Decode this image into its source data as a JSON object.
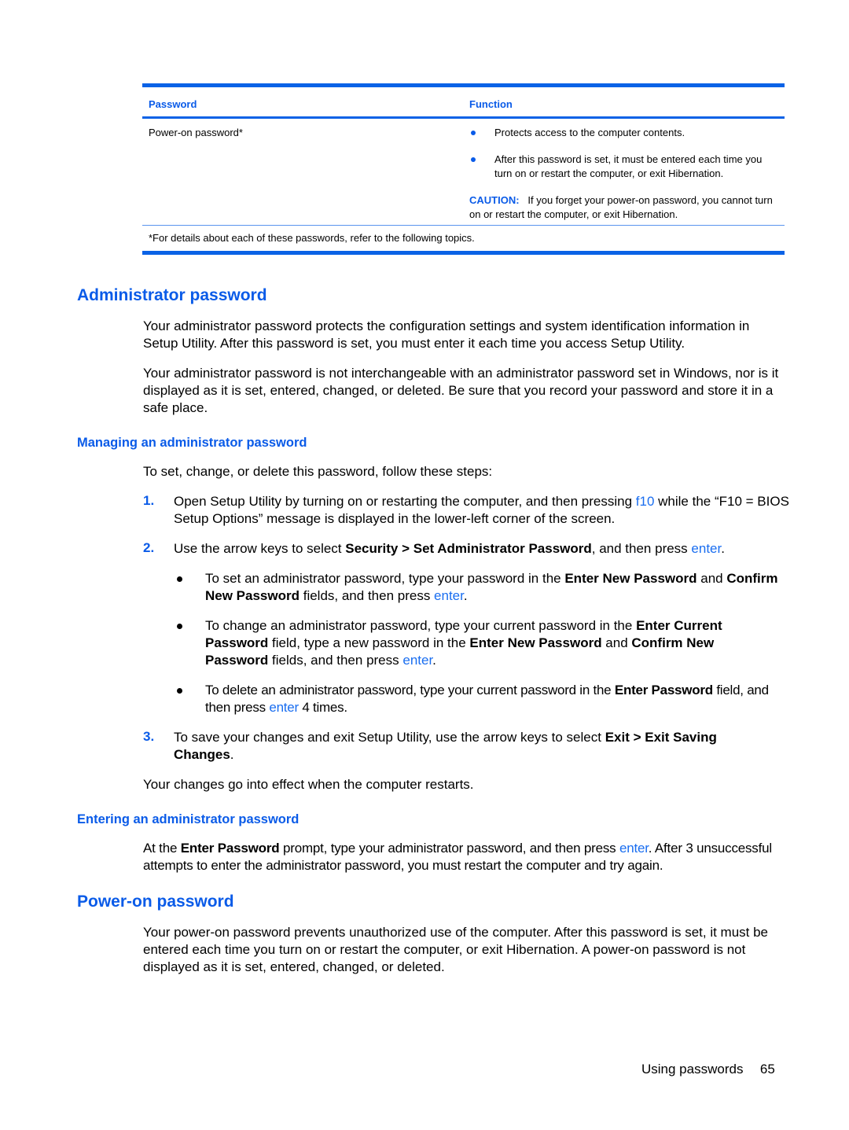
{
  "table": {
    "headers": [
      "Password",
      "Function"
    ],
    "row": {
      "password": "Power-on password*",
      "functions": [
        "Protects access to the computer contents.",
        "After this password is set, it must be entered each time you turn on or restart the computer, or exit Hibernation."
      ],
      "caution_label": "CAUTION:",
      "caution_text": "If you forget your power-on password, you cannot turn on or restart the computer, or exit Hibernation."
    },
    "footnote": "*For details about each of these passwords, refer to the following topics."
  },
  "admin": {
    "title": "Administrator password",
    "para1": "Your administrator password protects the configuration settings and system identification information in Setup Utility. After this password is set, you must enter it each time you access Setup Utility.",
    "para2": "Your administrator password is not interchangeable with an administrator password set in Windows, nor is it displayed as it is set, entered, changed, or deleted. Be sure that you record your password and store it in a safe place."
  },
  "managing": {
    "title": "Managing an administrator password",
    "intro": "To set, change, or delete this password, follow these steps:",
    "steps": [
      {
        "num": "1.",
        "t1": "Open Setup Utility by turning on or restarting the computer, and then pressing ",
        "key": "f10",
        "t2": " while the “F10 = BIOS Setup Options” message is displayed in the lower-left corner of the screen."
      },
      {
        "num": "2.",
        "t1": "Use the arrow keys to select ",
        "b1": "Security > Set Administrator Password",
        "t2": ", and then press ",
        "key": "enter",
        "t3": "."
      },
      {
        "num": "3.",
        "t1": "To save your changes and exit Setup Utility, use the arrow keys to select ",
        "b1": "Exit > Exit Saving Changes",
        "t2": "."
      }
    ],
    "bullets": [
      {
        "t1": "To set an administrator password, type your password in the ",
        "b1": "Enter New Password",
        "t2": " and ",
        "b2": "Confirm New Password",
        "t3": " fields, and then press ",
        "key": "enter",
        "t4": "."
      },
      {
        "t1": "To change an administrator password, type your current password in the ",
        "b1": "Enter Current Password",
        "t2": " field, type a new password in the ",
        "b2": "Enter New Password",
        "t3": " and ",
        "b3": "Confirm New Password",
        "t4": " fields, and then press ",
        "key": "enter",
        "t5": "."
      },
      {
        "t1": "To delete an administrator password, type your current password in the ",
        "b1": "Enter Password",
        "t2": " field, and then press ",
        "key": "enter",
        "t3": " 4 times."
      }
    ],
    "outro": "Your changes go into effect when the computer restarts."
  },
  "entering": {
    "title": "Entering an administrator password",
    "t1": "At the ",
    "b1": "Enter Password",
    "t2": " prompt, type your administrator password, and then press ",
    "key": "enter",
    "t3": ". After 3 unsuccessful attempts to enter the administrator password, you must restart the computer and try again."
  },
  "poweron": {
    "title": "Power-on password",
    "para": "Your power-on password prevents unauthorized use of the computer. After this password is set, it must be entered each time you turn on or restart the computer, or exit Hibernation. A power-on password is not displayed as it is set, entered, changed, or deleted."
  },
  "footer": {
    "section": "Using passwords",
    "page": "65"
  }
}
